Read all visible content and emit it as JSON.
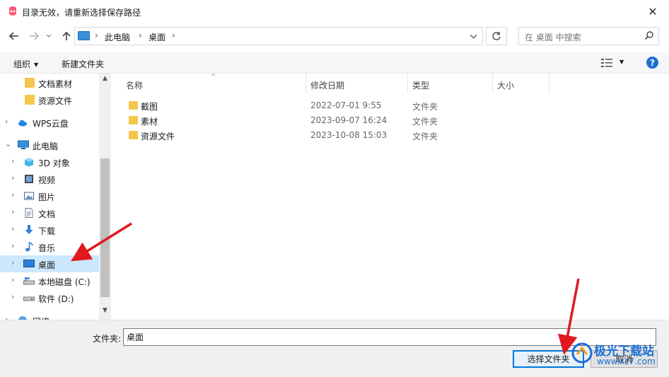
{
  "window": {
    "title": "目录无效，请重新选择保存路径",
    "close_glyph": "✕"
  },
  "address": {
    "crumbs": [
      "此电脑",
      "桌面"
    ],
    "search_placeholder": "在 桌面 中搜索"
  },
  "toolbar": {
    "organize_label": "组织",
    "new_folder_label": "新建文件夹",
    "help_label": "?"
  },
  "nav_tree": {
    "items": [
      {
        "label": "文档素材",
        "icon": "folder-icon",
        "has_chevron": false
      },
      {
        "label": "资源文件",
        "icon": "folder-icon",
        "has_chevron": false
      },
      {
        "label": "WPS云盘",
        "icon": "cloud-icon",
        "has_chevron": true
      },
      {
        "label": "此电脑",
        "icon": "computer-icon",
        "has_chevron": true,
        "expanded": true
      },
      {
        "label": "3D 对象",
        "icon": "cube-3d-icon",
        "has_chevron": true
      },
      {
        "label": "视频",
        "icon": "video-icon",
        "has_chevron": true
      },
      {
        "label": "图片",
        "icon": "pictures-icon",
        "has_chevron": true
      },
      {
        "label": "文档",
        "icon": "document-icon",
        "has_chevron": true
      },
      {
        "label": "下载",
        "icon": "download-icon",
        "has_chevron": true
      },
      {
        "label": "音乐",
        "icon": "music-icon",
        "has_chevron": true
      },
      {
        "label": "桌面",
        "icon": "desktop-icon",
        "has_chevron": true,
        "selected": true
      },
      {
        "label": "本地磁盘 (C:)",
        "icon": "drive-c-icon",
        "has_chevron": true
      },
      {
        "label": "软件 (D:)",
        "icon": "drive-d-icon",
        "has_chevron": true
      },
      {
        "label": "网络",
        "icon": "network-icon",
        "has_chevron": true
      }
    ]
  },
  "columns": {
    "name": "名称",
    "modified": "修改日期",
    "type": "类型",
    "size": "大小"
  },
  "files": [
    {
      "name": "截图",
      "modified": "2022-07-01 9:55",
      "type": "文件夹"
    },
    {
      "name": "素材",
      "modified": "2023-09-07 16:24",
      "type": "文件夹"
    },
    {
      "name": "资源文件",
      "modified": "2023-10-08 15:03",
      "type": "文件夹"
    }
  ],
  "bottom": {
    "folder_label": "文件夹:",
    "folder_value": "桌面",
    "select_button": "选择文件夹",
    "cancel_button": "取消"
  },
  "watermark": {
    "text": "极光下载站",
    "sub": "www.xz7.com"
  },
  "colors": {
    "accent": "#0078d7",
    "selection": "#cce8ff",
    "annotation_arrow": "#e0191f",
    "folder": "#f3c74c"
  }
}
